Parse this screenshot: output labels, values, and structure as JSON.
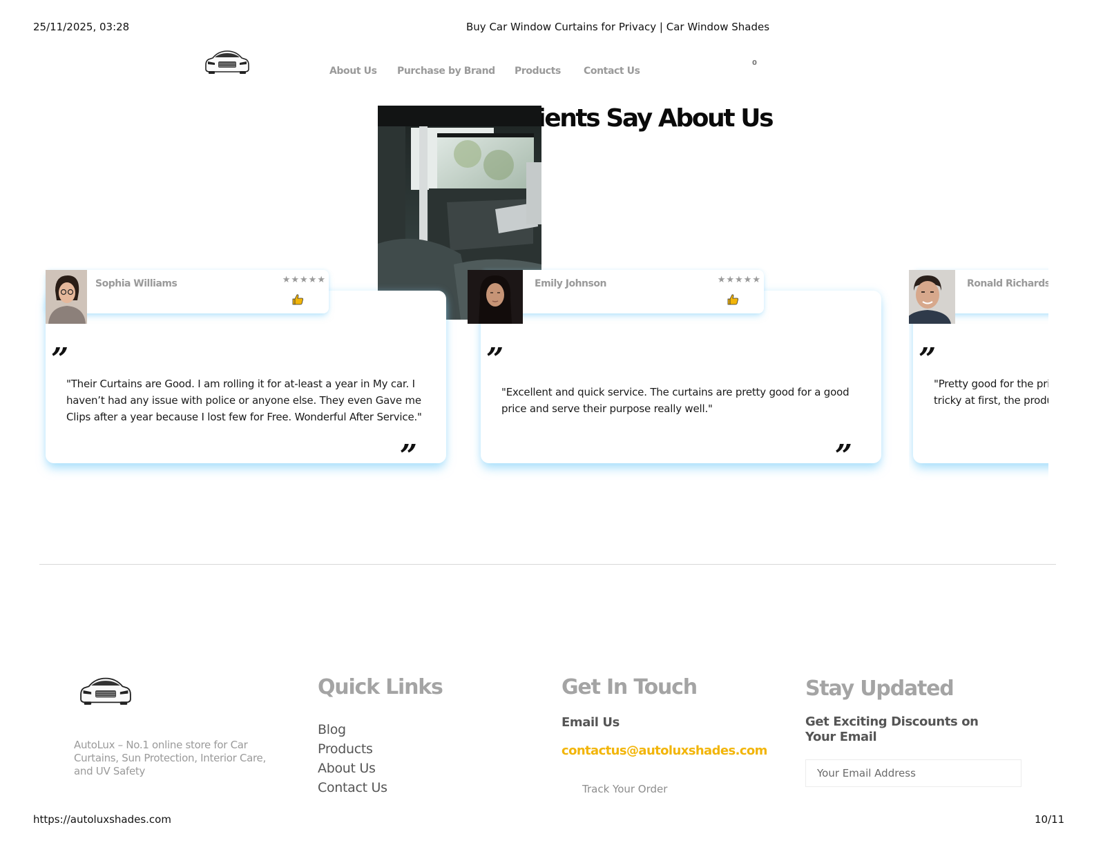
{
  "print_header": {
    "datetime": "25/11/2025, 03:28",
    "title": "Buy Car Window Curtains for Privacy | Car Window Shades"
  },
  "print_footer": {
    "url": "https://autoluxshades.com",
    "page": "10/11"
  },
  "nav": {
    "items": [
      {
        "label": "About Us"
      },
      {
        "label": "Purchase by Brand"
      },
      {
        "label": "Products"
      },
      {
        "label": "Contact Us"
      }
    ],
    "cart_count": "0"
  },
  "testimonials": {
    "title": "What Our Clients Say About Us",
    "stars": "★★★★★",
    "open_quote": "”",
    "close_quote": "”",
    "items": [
      {
        "name": "Sophia Williams",
        "text": "\"Their Curtains are Good. I am rolling it for at-least a year in My car. I haven’t had any issue with police or anyone else. They even Gave me Clips after a year because I lost few for Free. Wonderful After Service.\""
      },
      {
        "name": "Emily Johnson",
        "text": "\"Excellent and quick service. The curtains are pretty good for a good price and serve their purpose really well.\""
      },
      {
        "name": "Ronald Richards",
        "text": "\"Pretty good for the price. Followed the instruction's even though tricky at first, the product is great in quality.\""
      }
    ]
  },
  "footer": {
    "about": "AutoLux – No.1 online store for Car Curtains, Sun Protection, Interior Care, and UV Safety",
    "quick_links": {
      "title": "Quick Links",
      "items": [
        {
          "label": "Blog"
        },
        {
          "label": "Products"
        },
        {
          "label": "About Us"
        },
        {
          "label": "Contact Us"
        }
      ]
    },
    "contact": {
      "title": "Get In Touch",
      "email_label": "Email Us",
      "email": "contactus@autoluxshades.com",
      "track": "Track Your Order"
    },
    "newsletter": {
      "title": "Stay Updated",
      "subtitle": "Get Exciting Discounts on Your Email",
      "placeholder": "Your Email Address"
    }
  },
  "colors": {
    "accent": "#f2b50a",
    "muted_text": "#9a9a9a",
    "card_glow": "#78cdfa"
  },
  "icons": {
    "logo": "car-front-logo",
    "rating": "star-icon",
    "like": "thumbs-up-icon",
    "quote": "quote-icon"
  }
}
